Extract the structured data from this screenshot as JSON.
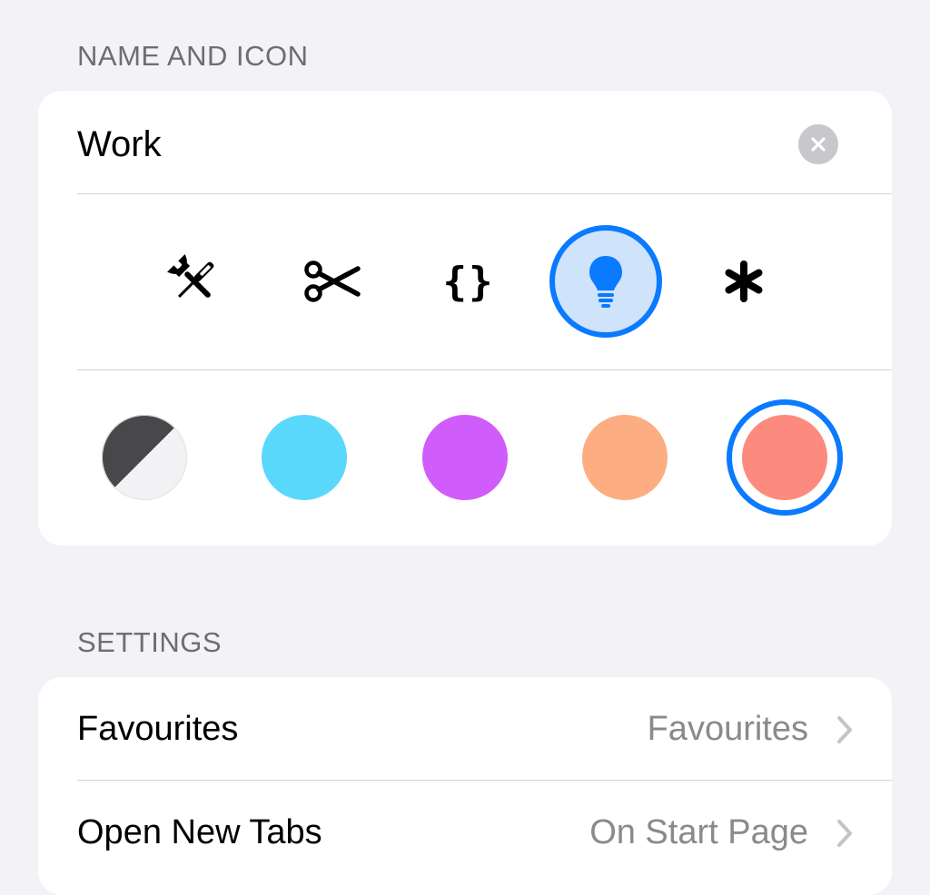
{
  "sections": {
    "name_and_icon_header": "NAME AND ICON",
    "settings_header": "SETTINGS"
  },
  "name_field": {
    "value": "Work",
    "clear_icon": "xmark-circle-icon"
  },
  "icons": {
    "items": [
      {
        "name": "tools-icon",
        "selected": false
      },
      {
        "name": "scissors-icon",
        "selected": false
      },
      {
        "name": "curly-braces-icon",
        "selected": false
      },
      {
        "name": "lightbulb-icon",
        "selected": true
      },
      {
        "name": "asterisk-icon",
        "selected": false
      }
    ],
    "curly_braces_glyph": "{}"
  },
  "colors": {
    "items": [
      {
        "name": "gray-split",
        "top": "#48484a",
        "bottom": "#f2f2f4",
        "selected": false
      },
      {
        "name": "cyan",
        "hex": "#5ad8fc",
        "selected": false
      },
      {
        "name": "purple",
        "hex": "#d05cfb",
        "selected": false
      },
      {
        "name": "orange",
        "hex": "#fdad82",
        "selected": false
      },
      {
        "name": "coral",
        "hex": "#fd8a7e",
        "selected": true
      }
    ],
    "selection_ring": "#0a7aff"
  },
  "settings": {
    "rows": [
      {
        "label": "Favourites",
        "value": "Favourites"
      },
      {
        "label": "Open New Tabs",
        "value": "On Start Page"
      }
    ]
  }
}
